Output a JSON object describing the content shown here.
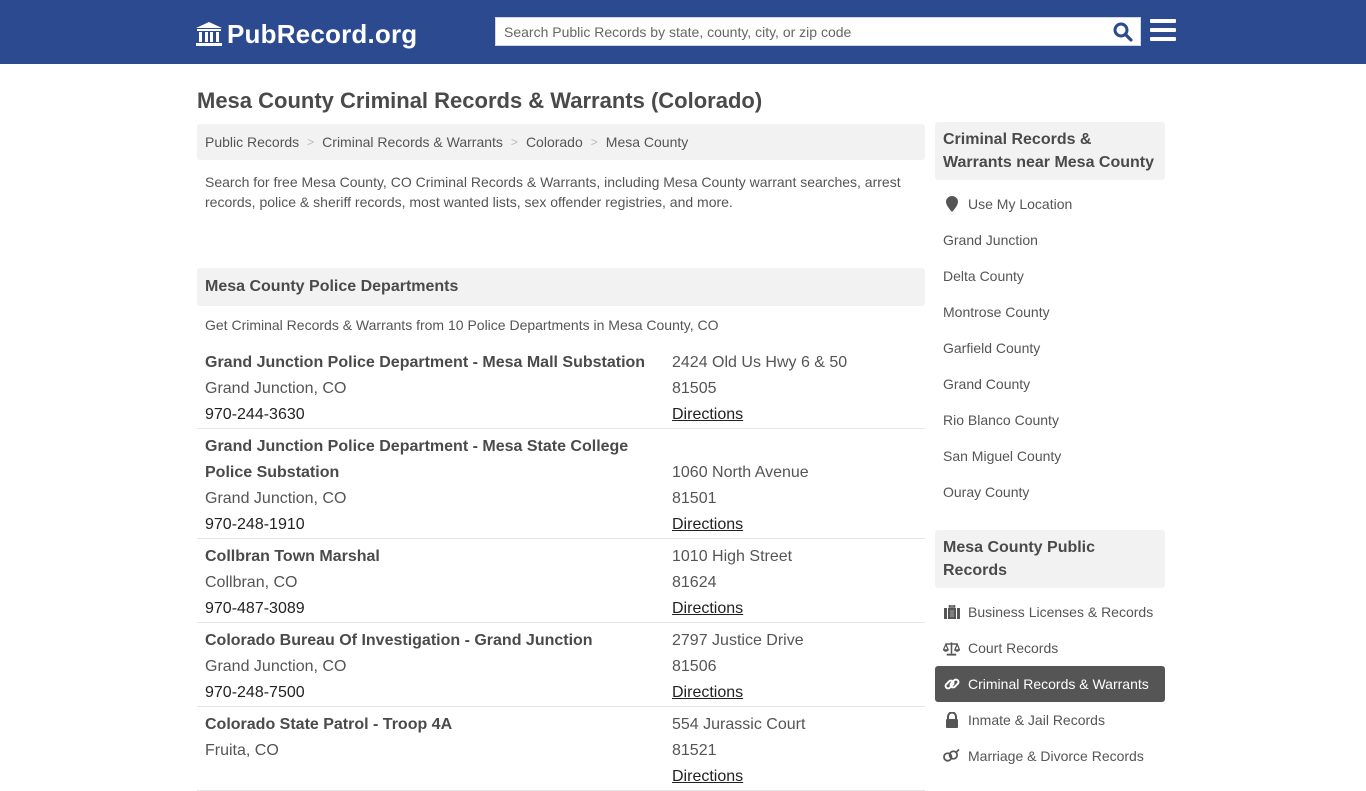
{
  "header": {
    "logo_text": "PubRecord.org",
    "search_placeholder": "Search Public Records by state, county, city, or zip code",
    "search_value": ""
  },
  "page_title": "Mesa County Criminal Records & Warrants (Colorado)",
  "breadcrumb": [
    {
      "label": "Public Records"
    },
    {
      "label": "Criminal Records & Warrants"
    },
    {
      "label": "Colorado"
    },
    {
      "label": "Mesa County"
    }
  ],
  "breadcrumb_separator": ">",
  "intro": "Search for free Mesa County, CO Criminal Records & Warrants, including Mesa County warrant searches, arrest records, police & sheriff records, most wanted lists, sex offender registries, and more.",
  "section": {
    "title": "Mesa County Police Departments",
    "subtitle": "Get Criminal Records & Warrants from 10 Police Departments in Mesa County, CO"
  },
  "departments": [
    {
      "name": "Grand Junction Police Department - Mesa Mall Substation",
      "city": "Grand Junction, CO",
      "phone": "970-244-3630",
      "address": "2424 Old Us Hwy 6 & 50",
      "zip": "81505",
      "directions": "Directions"
    },
    {
      "name": "Grand Junction Police Department - Mesa State College Police Substation",
      "city": "Grand Junction, CO",
      "phone": "970-248-1910",
      "address": "1060 North Avenue",
      "zip": "81501",
      "directions": "Directions"
    },
    {
      "name": "Collbran Town Marshal",
      "city": "Collbran, CO",
      "phone": "970-487-3089",
      "address": "1010 High Street",
      "zip": "81624",
      "directions": "Directions"
    },
    {
      "name": "Colorado Bureau Of Investigation - Grand Junction",
      "city": "Grand Junction, CO",
      "phone": "970-248-7500",
      "address": "2797 Justice Drive",
      "zip": "81506",
      "directions": "Directions"
    },
    {
      "name": "Colorado State Patrol - Troop 4A",
      "city": "Fruita, CO",
      "phone": "",
      "address": "554 Jurassic Court",
      "zip": "81521",
      "directions": "Directions"
    }
  ],
  "sidebar": {
    "nearby_title": "Criminal Records & Warrants near Mesa County",
    "use_location": "Use My Location",
    "nearby": [
      "Grand Junction",
      "Delta County",
      "Montrose County",
      "Garfield County",
      "Grand County",
      "Rio Blanco County",
      "San Miguel County",
      "Ouray County"
    ],
    "public_title": "Mesa County Public Records",
    "public_records": [
      {
        "label": "Business Licenses & Records",
        "icon": "briefcase-icon",
        "active": false
      },
      {
        "label": "Court Records",
        "icon": "scales-icon",
        "active": false
      },
      {
        "label": "Criminal Records & Warrants",
        "icon": "link-icon",
        "active": true
      },
      {
        "label": "Inmate & Jail Records",
        "icon": "lock-icon",
        "active": false
      },
      {
        "label": "Marriage & Divorce Records",
        "icon": "marriage-icon",
        "active": false
      }
    ]
  },
  "colors": {
    "header_bg": "#2c4a8f",
    "search_icon": "#2c4a8f",
    "active_item_bg": "#555555"
  }
}
